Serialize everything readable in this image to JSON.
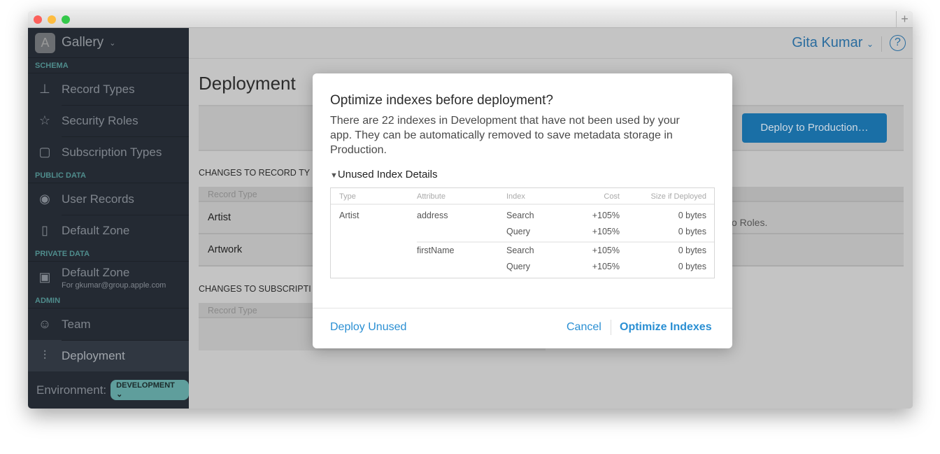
{
  "window": {
    "new_tab": "+"
  },
  "sidebar": {
    "app_name": "Gallery",
    "app_icon": "app-store-icon",
    "sections": [
      {
        "label": "SCHEMA",
        "items": [
          {
            "label": "Record Types",
            "icon": "hierarchy-icon"
          },
          {
            "label": "Security Roles",
            "icon": "badge-star-icon"
          },
          {
            "label": "Subscription Types",
            "icon": "notification-icon"
          }
        ]
      },
      {
        "label": "PUBLIC DATA",
        "items": [
          {
            "label": "User Records",
            "icon": "user-icon"
          },
          {
            "label": "Default Zone",
            "icon": "document-icon"
          }
        ]
      },
      {
        "label": "PRIVATE DATA",
        "items": [
          {
            "label": "Default Zone",
            "sublabel": "For gkumar@group.apple.com",
            "icon": "lock-document-icon"
          }
        ]
      },
      {
        "label": "ADMIN",
        "items": [
          {
            "label": "Team",
            "icon": "team-icon"
          },
          {
            "label": "Deployment",
            "icon": "sliders-icon",
            "selected": true
          }
        ]
      }
    ],
    "environment_label": "Environment:",
    "environment_value": "DEVELOPMENT"
  },
  "header": {
    "user": "Gita Kumar",
    "help": "?"
  },
  "main": {
    "title": "Deployment",
    "deploy_button": "Deploy to Production…",
    "record_changes_label": "CHANGES TO RECORD TY",
    "record_col": "Record Type",
    "record_rows": [
      "Artist",
      "Artwork"
    ],
    "roles_note": "o Roles.",
    "subscription_label": "CHANGES TO SUBSCRIPTI",
    "subscription_col": "Record Type"
  },
  "modal": {
    "title": "Optimize indexes before deployment?",
    "description": "There are 22 indexes in Development that have not been used by your app. They can be automatically removed to save metadata storage in Production.",
    "disclosure": "Unused Index Details",
    "columns": [
      "Type",
      "Attribute",
      "Index",
      "Cost",
      "Size if Deployed"
    ],
    "rows": [
      [
        "Artist",
        "address",
        "Search",
        "+105%",
        "0 bytes"
      ],
      [
        "",
        "",
        "Query",
        "+105%",
        "0 bytes"
      ],
      [
        "",
        "firstName",
        "Search",
        "+105%",
        "0 bytes"
      ],
      [
        "",
        "",
        "Query",
        "+105%",
        "0 bytes"
      ]
    ],
    "deploy_unused": "Deploy Unused",
    "cancel": "Cancel",
    "optimize": "Optimize Indexes"
  },
  "colors": {
    "accent": "#2a8fd3",
    "sidebar": "#242a33",
    "deploy_button": "#1a6fa6",
    "environment_badge": "#5f9e9c"
  }
}
